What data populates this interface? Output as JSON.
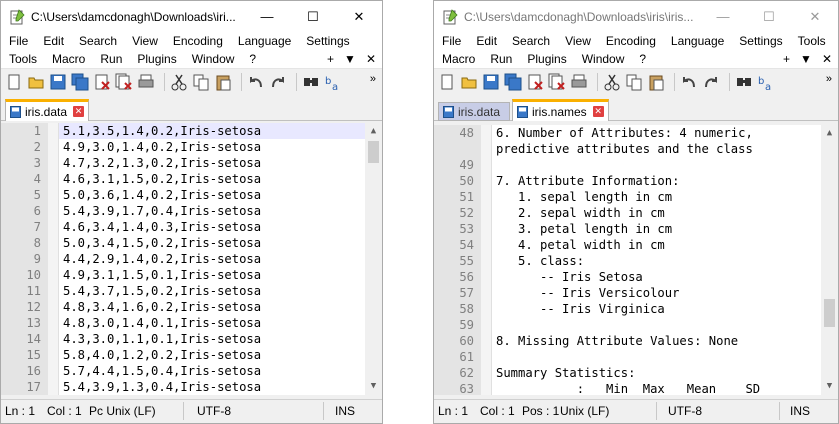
{
  "win1": {
    "title": "C:\\Users\\damcdonagh\\Downloads\\iri...",
    "menu_row1": [
      "File",
      "Edit",
      "Search",
      "View",
      "Encoding",
      "Language",
      "Settings"
    ],
    "menu_row2": [
      "Tools",
      "Macro",
      "Run",
      "Plugins",
      "Window",
      "?"
    ],
    "menu_row2_right": [
      "+",
      "▼",
      "✕"
    ],
    "tabs": [
      {
        "label": "iris.data",
        "active": true
      }
    ],
    "lines": [
      {
        "n": "1",
        "t": "5.1,3.5,1.4,0.2,Iris-setosa"
      },
      {
        "n": "2",
        "t": "4.9,3.0,1.4,0.2,Iris-setosa"
      },
      {
        "n": "3",
        "t": "4.7,3.2,1.3,0.2,Iris-setosa"
      },
      {
        "n": "4",
        "t": "4.6,3.1,1.5,0.2,Iris-setosa"
      },
      {
        "n": "5",
        "t": "5.0,3.6,1.4,0.2,Iris-setosa"
      },
      {
        "n": "6",
        "t": "5.4,3.9,1.7,0.4,Iris-setosa"
      },
      {
        "n": "7",
        "t": "4.6,3.4,1.4,0.3,Iris-setosa"
      },
      {
        "n": "8",
        "t": "5.0,3.4,1.5,0.2,Iris-setosa"
      },
      {
        "n": "9",
        "t": "4.4,2.9,1.4,0.2,Iris-setosa"
      },
      {
        "n": "10",
        "t": "4.9,3.1,1.5,0.1,Iris-setosa"
      },
      {
        "n": "11",
        "t": "5.4,3.7,1.5,0.2,Iris-setosa"
      },
      {
        "n": "12",
        "t": "4.8,3.4,1.6,0.2,Iris-setosa"
      },
      {
        "n": "13",
        "t": "4.8,3.0,1.4,0.1,Iris-setosa"
      },
      {
        "n": "14",
        "t": "4.3,3.0,1.1,0.1,Iris-setosa"
      },
      {
        "n": "15",
        "t": "5.8,4.0,1.2,0.2,Iris-setosa"
      },
      {
        "n": "16",
        "t": "5.7,4.4,1.5,0.4,Iris-setosa"
      },
      {
        "n": "17",
        "t": "5.4,3.9,1.3,0.4,Iris-setosa"
      }
    ],
    "status": {
      "ln": "Ln : 1",
      "col": "Col : 1",
      "eol": "Pc Unix (LF)",
      "enc": "UTF-8",
      "mode": "INS"
    }
  },
  "win2": {
    "title": "C:\\Users\\damcdonagh\\Downloads\\iris\\iris...",
    "menu_row1": [
      "File",
      "Edit",
      "Search",
      "View",
      "Encoding",
      "Language",
      "Settings",
      "Tools"
    ],
    "menu_row2": [
      "Macro",
      "Run",
      "Plugins",
      "Window",
      "?"
    ],
    "menu_row2_right": [
      "+",
      "▼",
      "✕"
    ],
    "tabs": [
      {
        "label": "iris.data",
        "active": false
      },
      {
        "label": "iris.names",
        "active": true
      }
    ],
    "lines": [
      {
        "n": "48",
        "t": "6. Number of Attributes: 4 numeric,"
      },
      {
        "n": "",
        "t": "predictive attributes and the class"
      },
      {
        "n": "49",
        "t": ""
      },
      {
        "n": "50",
        "t": "7. Attribute Information:"
      },
      {
        "n": "51",
        "t": "   1. sepal length in cm"
      },
      {
        "n": "52",
        "t": "   2. sepal width in cm"
      },
      {
        "n": "53",
        "t": "   3. petal length in cm"
      },
      {
        "n": "54",
        "t": "   4. petal width in cm"
      },
      {
        "n": "55",
        "t": "   5. class:"
      },
      {
        "n": "56",
        "t": "      -- Iris Setosa"
      },
      {
        "n": "57",
        "t": "      -- Iris Versicolour"
      },
      {
        "n": "58",
        "t": "      -- Iris Virginica"
      },
      {
        "n": "59",
        "t": ""
      },
      {
        "n": "60",
        "t": "8. Missing Attribute Values: None"
      },
      {
        "n": "61",
        "t": ""
      },
      {
        "n": "62",
        "t": "Summary Statistics:"
      },
      {
        "n": "63",
        "t": "           :   Min  Max   Mean    SD"
      }
    ],
    "status": {
      "ln": "Ln : 1",
      "col": "Col : 1",
      "pos": "Pos : 1",
      "eol": "Unix (LF)",
      "enc": "UTF-8",
      "mode": "INS"
    }
  },
  "caption_buttons": {
    "minimize": "—",
    "maximize": "☐",
    "close": "✕"
  },
  "toolbar_icons": [
    "new-file-icon",
    "open-file-icon",
    "save-icon",
    "save-all-icon",
    "close-icon",
    "close-all-icon",
    "print-icon",
    "cut-icon",
    "copy-icon",
    "paste-icon",
    "undo-icon",
    "redo-icon",
    "find-icon",
    "replace-icon"
  ],
  "colors": {
    "tab_accent": "#fab000",
    "gutter": "#e4e4e4",
    "current_line": "#e8e8ff",
    "close_red": "#e04040"
  }
}
